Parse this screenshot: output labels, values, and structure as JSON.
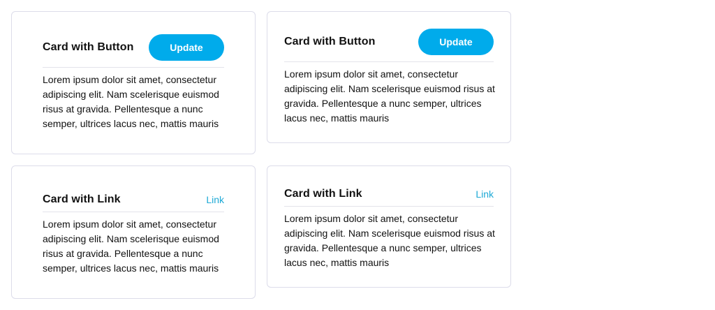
{
  "colors": {
    "accent": "#00abeb",
    "link": "#1da9d6",
    "border": "#dcdcea",
    "text": "#111111"
  },
  "cards": [
    {
      "title": "Card with Button",
      "action_label": "Update",
      "body": "Lorem ipsum dolor sit amet, consectetur adipiscing elit. Nam scelerisque euismod risus at gravida. Pellentesque a nunc semper, ultrices lacus nec, mattis mauris"
    },
    {
      "title": "Card with Button",
      "action_label": "Update",
      "body": "Lorem ipsum dolor sit amet, consectetur adipiscing elit. Nam scelerisque euismod risus at gravida. Pellentesque a nunc semper, ultrices lacus nec, mattis mauris"
    },
    {
      "title": "Card with Link",
      "action_label": "Link",
      "body": "Lorem ipsum dolor sit amet, consectetur adipiscing elit. Nam scelerisque euismod risus at gravida. Pellentesque a nunc semper, ultrices lacus nec, mattis mauris"
    },
    {
      "title": "Card with Link",
      "action_label": "Link",
      "body": "Lorem ipsum dolor sit amet, consectetur adipiscing elit. Nam scelerisque euismod risus at gravida. Pellentesque a nunc semper, ultrices lacus nec, mattis mauris"
    }
  ]
}
